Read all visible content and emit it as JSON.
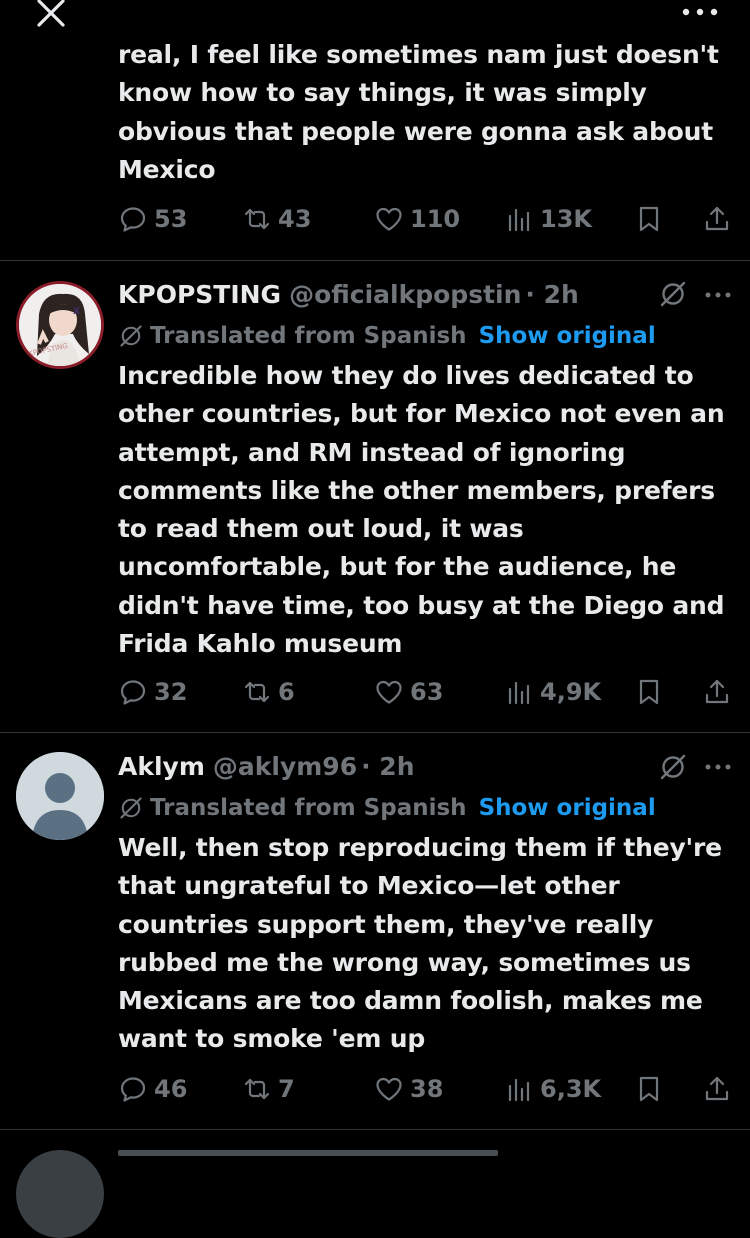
{
  "top": {
    "close_icon": "close-icon",
    "more_icon": "more-icon",
    "text": "real, I feel like sometimes nam just doesn't\nknow how to say things, it was simply\nobvious that people were gonna ask about\nMexico",
    "stats": {
      "replies": "53",
      "reposts": "43",
      "likes": "110",
      "views": "13K"
    }
  },
  "posts": [
    {
      "name": "KPOPSTING",
      "handle": "@oficialkpopstin",
      "time": "· 2h",
      "translated_label": "Translated from Spanish",
      "show_original": "Show original",
      "avatar_text": "KPOPSTING",
      "text": "Incredible how they do lives dedicated to\nother countries, but for Mexico not even an\nattempt, and RM instead of ignoring\ncomments like the other members, prefers\nto read them out loud, it was\nuncomfortable, but for the audience, he\ndidn't have time, too busy at the Diego and\nFrida Kahlo museum",
      "stats": {
        "replies": "32",
        "reposts": "6",
        "likes": "63",
        "views": "4,9K"
      }
    },
    {
      "name": "Aklym",
      "handle": "@aklym96",
      "time": "· 2h",
      "translated_label": "Translated from Spanish",
      "show_original": "Show original",
      "text": "Well, then stop reproducing them if they're\nthat ungrateful to Mexico—let other\ncountries support them, they've really\nrubbed me the wrong way, sometimes us\nMexicans are too damn foolish, makes me\nwant to smoke 'em up",
      "stats": {
        "replies": "46",
        "reposts": "7",
        "likes": "38",
        "views": "6,3K"
      }
    }
  ],
  "colors": {
    "background": "#000000",
    "text": "#e7e9ea",
    "muted": "#71767b",
    "link": "#1d9bf0",
    "divider": "#2f3336"
  }
}
